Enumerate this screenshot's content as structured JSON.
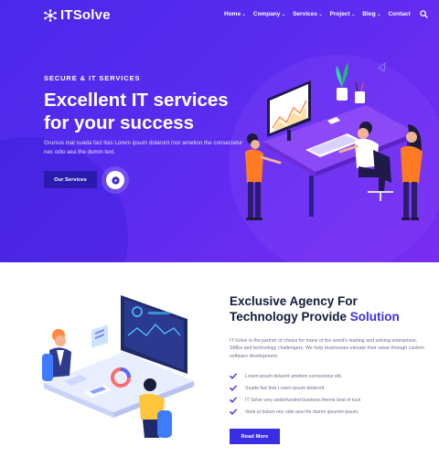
{
  "brand": {
    "name": "ITSolve"
  },
  "nav": {
    "items": [
      {
        "label": "Home",
        "has_dropdown": true
      },
      {
        "label": "Company",
        "has_dropdown": true
      },
      {
        "label": "Services",
        "has_dropdown": true
      },
      {
        "label": "Project",
        "has_dropdown": true
      },
      {
        "label": "Blog",
        "has_dropdown": true
      },
      {
        "label": "Contact",
        "has_dropdown": false
      }
    ],
    "search_icon": "search-icon"
  },
  "hero": {
    "kicker": "SECURE & IT SERVICES",
    "title_line1": "Excellent IT services",
    "title_line2": "for your success",
    "description": "Grursus mal suada faci lisis Lorem ipsum dolarorit mor ametion the consectetur nec odio aea the dumm text.",
    "button_label": "Our Services",
    "play_icon": "play-icon"
  },
  "about": {
    "title_line1": "Exclusive Agency For",
    "title_line2_prefix": "Technology Provide ",
    "title_line2_accent": "Solution",
    "description": "IT-Solve is the partner of choice for many of the world's leading and solving enterprises, SMEs and technology challengers. We help businesses elevate their value through custom software development.",
    "checklist": [
      "Lorem ipsum dolaorit ametion consectetur elit.",
      "Suada faci lisis Lorem ipsum dolarorit.",
      "IT Solve very underfunded business theme best of luck",
      "Vesti at bulum nec odio aea the dumm ipsumm ipsum."
    ],
    "button_label": "Read More"
  },
  "colors": {
    "hero_gradient_start": "#4a28ea",
    "hero_gradient_end": "#7a2cf2",
    "accent": "#3d30e6",
    "heading_dark": "#101c3a",
    "body_text": "#6b7289",
    "hero_button": "#2a1ab0"
  }
}
